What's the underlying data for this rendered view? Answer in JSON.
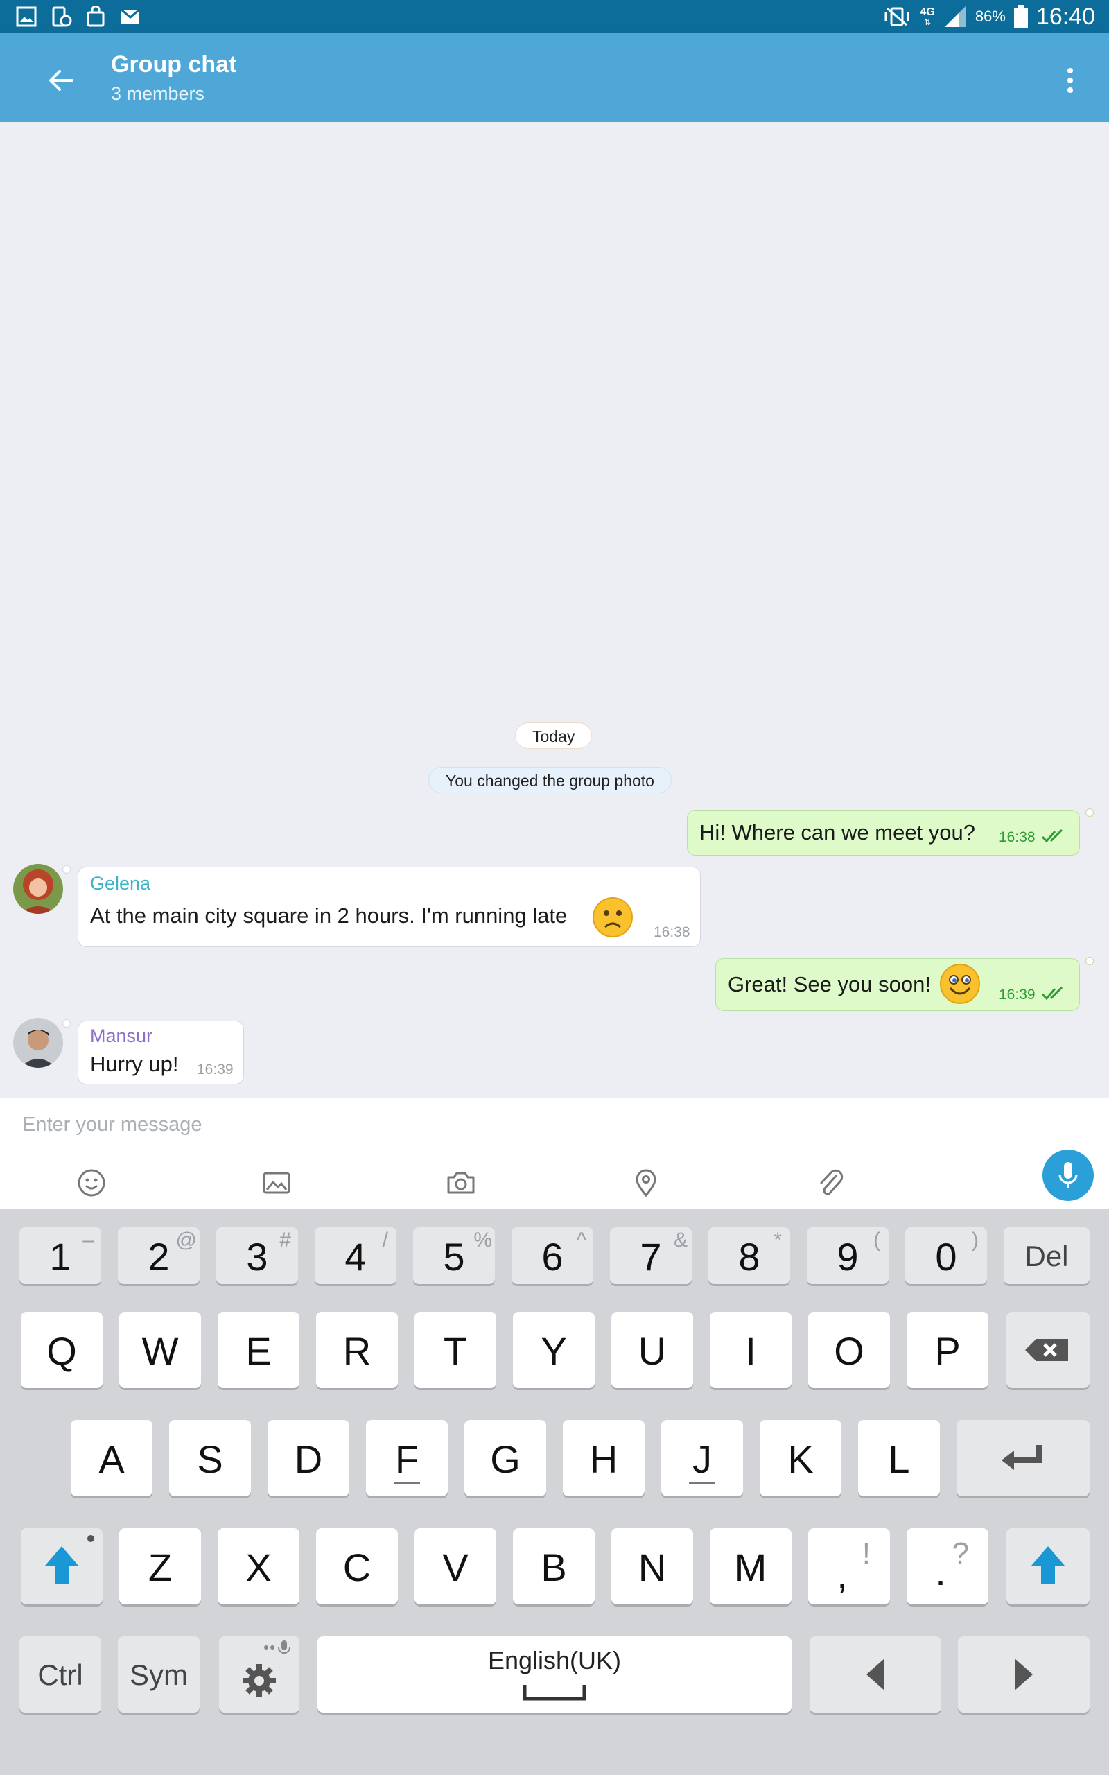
{
  "status_bar": {
    "network": "4G",
    "battery": "86%",
    "time": "16:40"
  },
  "header": {
    "title": "Group chat",
    "subtitle": "3 members"
  },
  "chat": {
    "date_separator": "Today",
    "system_message": "You changed the group photo",
    "messages": [
      {
        "direction": "outgoing",
        "text": "Hi! Where can we meet you?",
        "time": "16:38"
      },
      {
        "direction": "incoming",
        "sender": "Gelena",
        "text": "At the main city square in 2 hours. I'm running late",
        "time": "16:38"
      },
      {
        "direction": "outgoing",
        "text": "Great! See you soon!",
        "time": "16:39"
      },
      {
        "direction": "incoming",
        "sender": "Mansur",
        "text": "Hurry up!",
        "time": "16:39"
      }
    ]
  },
  "composer": {
    "placeholder": "Enter your message"
  },
  "keyboard": {
    "number_row": [
      {
        "main": "1",
        "alt": "–"
      },
      {
        "main": "2",
        "alt": "@"
      },
      {
        "main": "3",
        "alt": "#"
      },
      {
        "main": "4",
        "alt": "/"
      },
      {
        "main": "5",
        "alt": "%"
      },
      {
        "main": "6",
        "alt": "^"
      },
      {
        "main": "7",
        "alt": "&"
      },
      {
        "main": "8",
        "alt": "*"
      },
      {
        "main": "9",
        "alt": "("
      },
      {
        "main": "0",
        "alt": ")"
      }
    ],
    "del_label": "Del",
    "row1": [
      "Q",
      "W",
      "E",
      "R",
      "T",
      "Y",
      "U",
      "I",
      "O",
      "P"
    ],
    "row2": [
      "A",
      "S",
      "D",
      "F",
      "G",
      "H",
      "J",
      "K",
      "L"
    ],
    "row3": [
      "Z",
      "X",
      "C",
      "V",
      "B",
      "N",
      "M"
    ],
    "comma": {
      "main": ",",
      "alt": "!"
    },
    "period": {
      "main": ".",
      "alt": "?"
    },
    "ctrl_label": "Ctrl",
    "sym_label": "Sym",
    "space_label": "English(UK)"
  },
  "colors": {
    "header": "#4fa7d8",
    "status_bar": "#0d6d9a",
    "outgoing_bubble": "#ddfac8",
    "accent": "#2a9fd8"
  }
}
